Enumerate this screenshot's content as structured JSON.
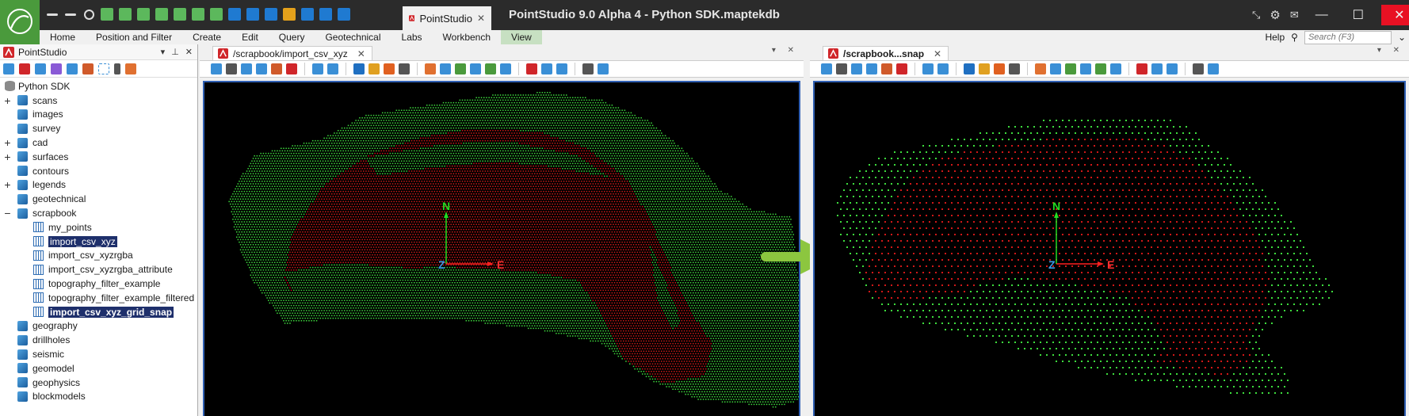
{
  "app": {
    "window_title": "PointStudio 9.0 Alpha 4 - Python SDK.maptekdb",
    "tab_title": "PointStudio",
    "brand_color": "#4a9a3c"
  },
  "menu": {
    "items": [
      "Home",
      "Position and Filter",
      "Create",
      "Edit",
      "Query",
      "Geotechnical",
      "Labs",
      "Workbench",
      "View"
    ],
    "active": "View",
    "help": "Help",
    "search_placeholder": "Search (F3)"
  },
  "left_panel": {
    "title": "PointStudio",
    "root": "Python SDK",
    "items": [
      {
        "label": "scans",
        "icon": "container-icon",
        "expander": "+"
      },
      {
        "label": "images",
        "icon": "container-icon",
        "expander": ""
      },
      {
        "label": "survey",
        "icon": "container-icon",
        "expander": ""
      },
      {
        "label": "cad",
        "icon": "container-icon",
        "expander": "+"
      },
      {
        "label": "surfaces",
        "icon": "container-icon",
        "expander": "+"
      },
      {
        "label": "contours",
        "icon": "container-icon",
        "expander": ""
      },
      {
        "label": "legends",
        "icon": "container-icon",
        "expander": "+"
      },
      {
        "label": "geotechnical",
        "icon": "container-icon",
        "expander": ""
      },
      {
        "label": "scrapbook",
        "icon": "container-icon",
        "expander": "−"
      },
      {
        "label": "my_points",
        "icon": "pointset-icon",
        "child": true
      },
      {
        "label": "import_csv_xyz",
        "icon": "pointset-icon",
        "child": true,
        "selected": true
      },
      {
        "label": "import_csv_xyzrgba",
        "icon": "pointset-icon",
        "child": true
      },
      {
        "label": "import_csv_xyzrgba_attribute",
        "icon": "pointset-icon",
        "child": true
      },
      {
        "label": "topography_filter_example",
        "icon": "pointset-icon",
        "child": true
      },
      {
        "label": "topography_filter_example_filtered",
        "icon": "pointset-icon",
        "child": true
      },
      {
        "label": "import_csv_xyz_grid_snap",
        "icon": "pointset-icon",
        "child": true,
        "selected": true,
        "bold": true
      },
      {
        "label": "geography",
        "icon": "container-icon",
        "expander": ""
      },
      {
        "label": "drillholes",
        "icon": "container-icon",
        "expander": ""
      },
      {
        "label": "seismic",
        "icon": "container-icon",
        "expander": ""
      },
      {
        "label": "geomodel",
        "icon": "container-icon",
        "expander": ""
      },
      {
        "label": "geophysics",
        "icon": "container-icon",
        "expander": ""
      },
      {
        "label": "blockmodels",
        "icon": "container-icon",
        "expander": ""
      }
    ]
  },
  "views": {
    "left": {
      "tab": "/scrapbook/import_csv_xyz"
    },
    "right": {
      "tab": "/scrapbook...snap"
    }
  },
  "axes": {
    "north": "N",
    "east": "E",
    "up": "Z"
  },
  "colors": {
    "green_points": "#3ddc3d",
    "red_points": "#d01818",
    "arrow": "#8cc63f",
    "selection": "#1e2f6b",
    "viewport_border": "#2f5fb3"
  }
}
